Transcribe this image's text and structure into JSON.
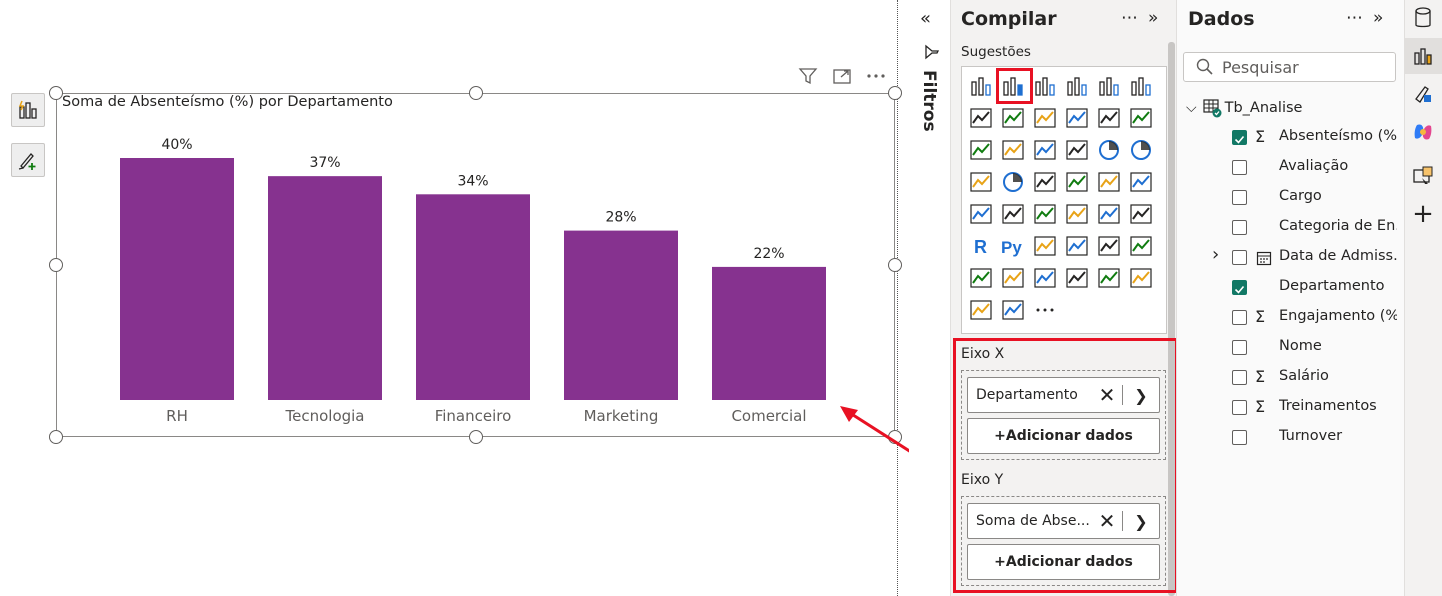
{
  "canvas": {
    "visual_title": "Soma de Absenteísmo (%) por Departamento",
    "icons": [
      "filter-icon",
      "focus-mode-icon",
      "more-options-icon"
    ]
  },
  "chart_data": {
    "type": "bar",
    "title": "Soma de Absenteísmo (%) por Departamento",
    "categories": [
      "RH",
      "Tecnologia",
      "Financeiro",
      "Marketing",
      "Comercial"
    ],
    "values": [
      40,
      37,
      34,
      28,
      22
    ],
    "data_labels": [
      "40%",
      "37%",
      "34%",
      "28%",
      "22%"
    ],
    "ylim": [
      0,
      40
    ],
    "bar_color": "#86328F",
    "grid": false
  },
  "filters": {
    "label": "Filtros"
  },
  "build": {
    "title": "Compilar",
    "suggestions_label": "Sugestões",
    "axis_x": {
      "label": "Eixo X",
      "field": "Departamento",
      "add_label": "+Adicionar dados"
    },
    "axis_y": {
      "label": "Eixo Y",
      "field": "Soma de Abse...",
      "add_label": "+Adicionar dados"
    },
    "highlight_color": "#E81123"
  },
  "data_pane": {
    "title": "Dados",
    "search_placeholder": "Pesquisar",
    "table_name": "Tb_Analise",
    "fields": [
      {
        "name": "Absenteísmo (%)",
        "sigma": true,
        "checked": true
      },
      {
        "name": "Avaliação",
        "sigma": false,
        "checked": false
      },
      {
        "name": "Cargo",
        "sigma": false,
        "checked": false
      },
      {
        "name": "Categoria de En...",
        "sigma": false,
        "checked": false
      },
      {
        "name": "Data de Admiss...",
        "sigma": false,
        "checked": false,
        "calendar": true,
        "expandable": true
      },
      {
        "name": "Departamento",
        "sigma": false,
        "checked": true,
        "no_box": true
      },
      {
        "name": "Engajamento (%)",
        "sigma": true,
        "checked": false
      },
      {
        "name": "Nome",
        "sigma": false,
        "checked": false
      },
      {
        "name": "Salário",
        "sigma": true,
        "checked": false
      },
      {
        "name": "Treinamentos",
        "sigma": true,
        "checked": false
      },
      {
        "name": "Turnover",
        "sigma": false,
        "checked": false
      }
    ]
  }
}
